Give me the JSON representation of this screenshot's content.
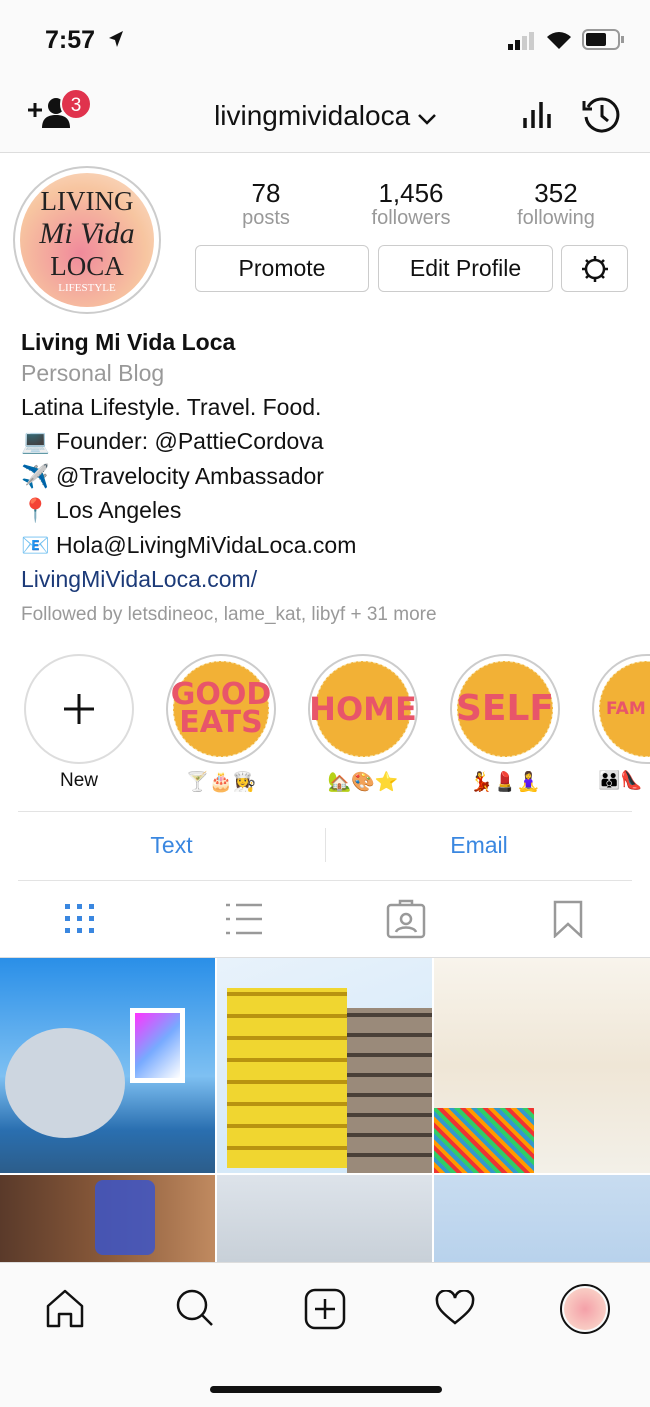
{
  "status_bar": {
    "time": "7:57"
  },
  "header": {
    "username": "livingmividaloca",
    "notification_count": "3"
  },
  "profile": {
    "avatar_text": [
      "LIVING",
      "Mi Vida",
      "LOCA",
      "LIFESTYLE"
    ],
    "stats": [
      {
        "value": "78",
        "label": "posts"
      },
      {
        "value": "1,456",
        "label": "followers"
      },
      {
        "value": "352",
        "label": "following"
      }
    ],
    "buttons": {
      "promote": "Promote",
      "edit": "Edit Profile"
    },
    "name": "Living Mi Vida Loca",
    "category": "Personal Blog",
    "bio": [
      "Latina Lifestyle. Travel. Food.",
      "💻 Founder: @PattieCordova",
      "✈️ @Travelocity Ambassador",
      "📍 Los Angeles",
      "📧 Hola@LivingMiVidaLoca.com"
    ],
    "website": "LivingMiVidaLoca.com/",
    "followed_by": "Followed by letsdineoc, lame_kat, libyf + 31 more"
  },
  "highlights": [
    {
      "cover": "",
      "label": "New"
    },
    {
      "cover": "GOOD EATS",
      "label": "🍸🎂👩‍🍳"
    },
    {
      "cover": "HOME",
      "label": "🏡🎨⭐"
    },
    {
      "cover": "SELF",
      "label": "💃💄🧘‍♀️"
    },
    {
      "cover": "FAM",
      "label": "👪👠"
    }
  ],
  "contact": {
    "text": "Text",
    "email": "Email"
  },
  "colors": {
    "accent": "#3a87e0",
    "badge": "#e0334d",
    "highlight_bg": "#f2b136",
    "highlight_text": "#e8556a"
  }
}
